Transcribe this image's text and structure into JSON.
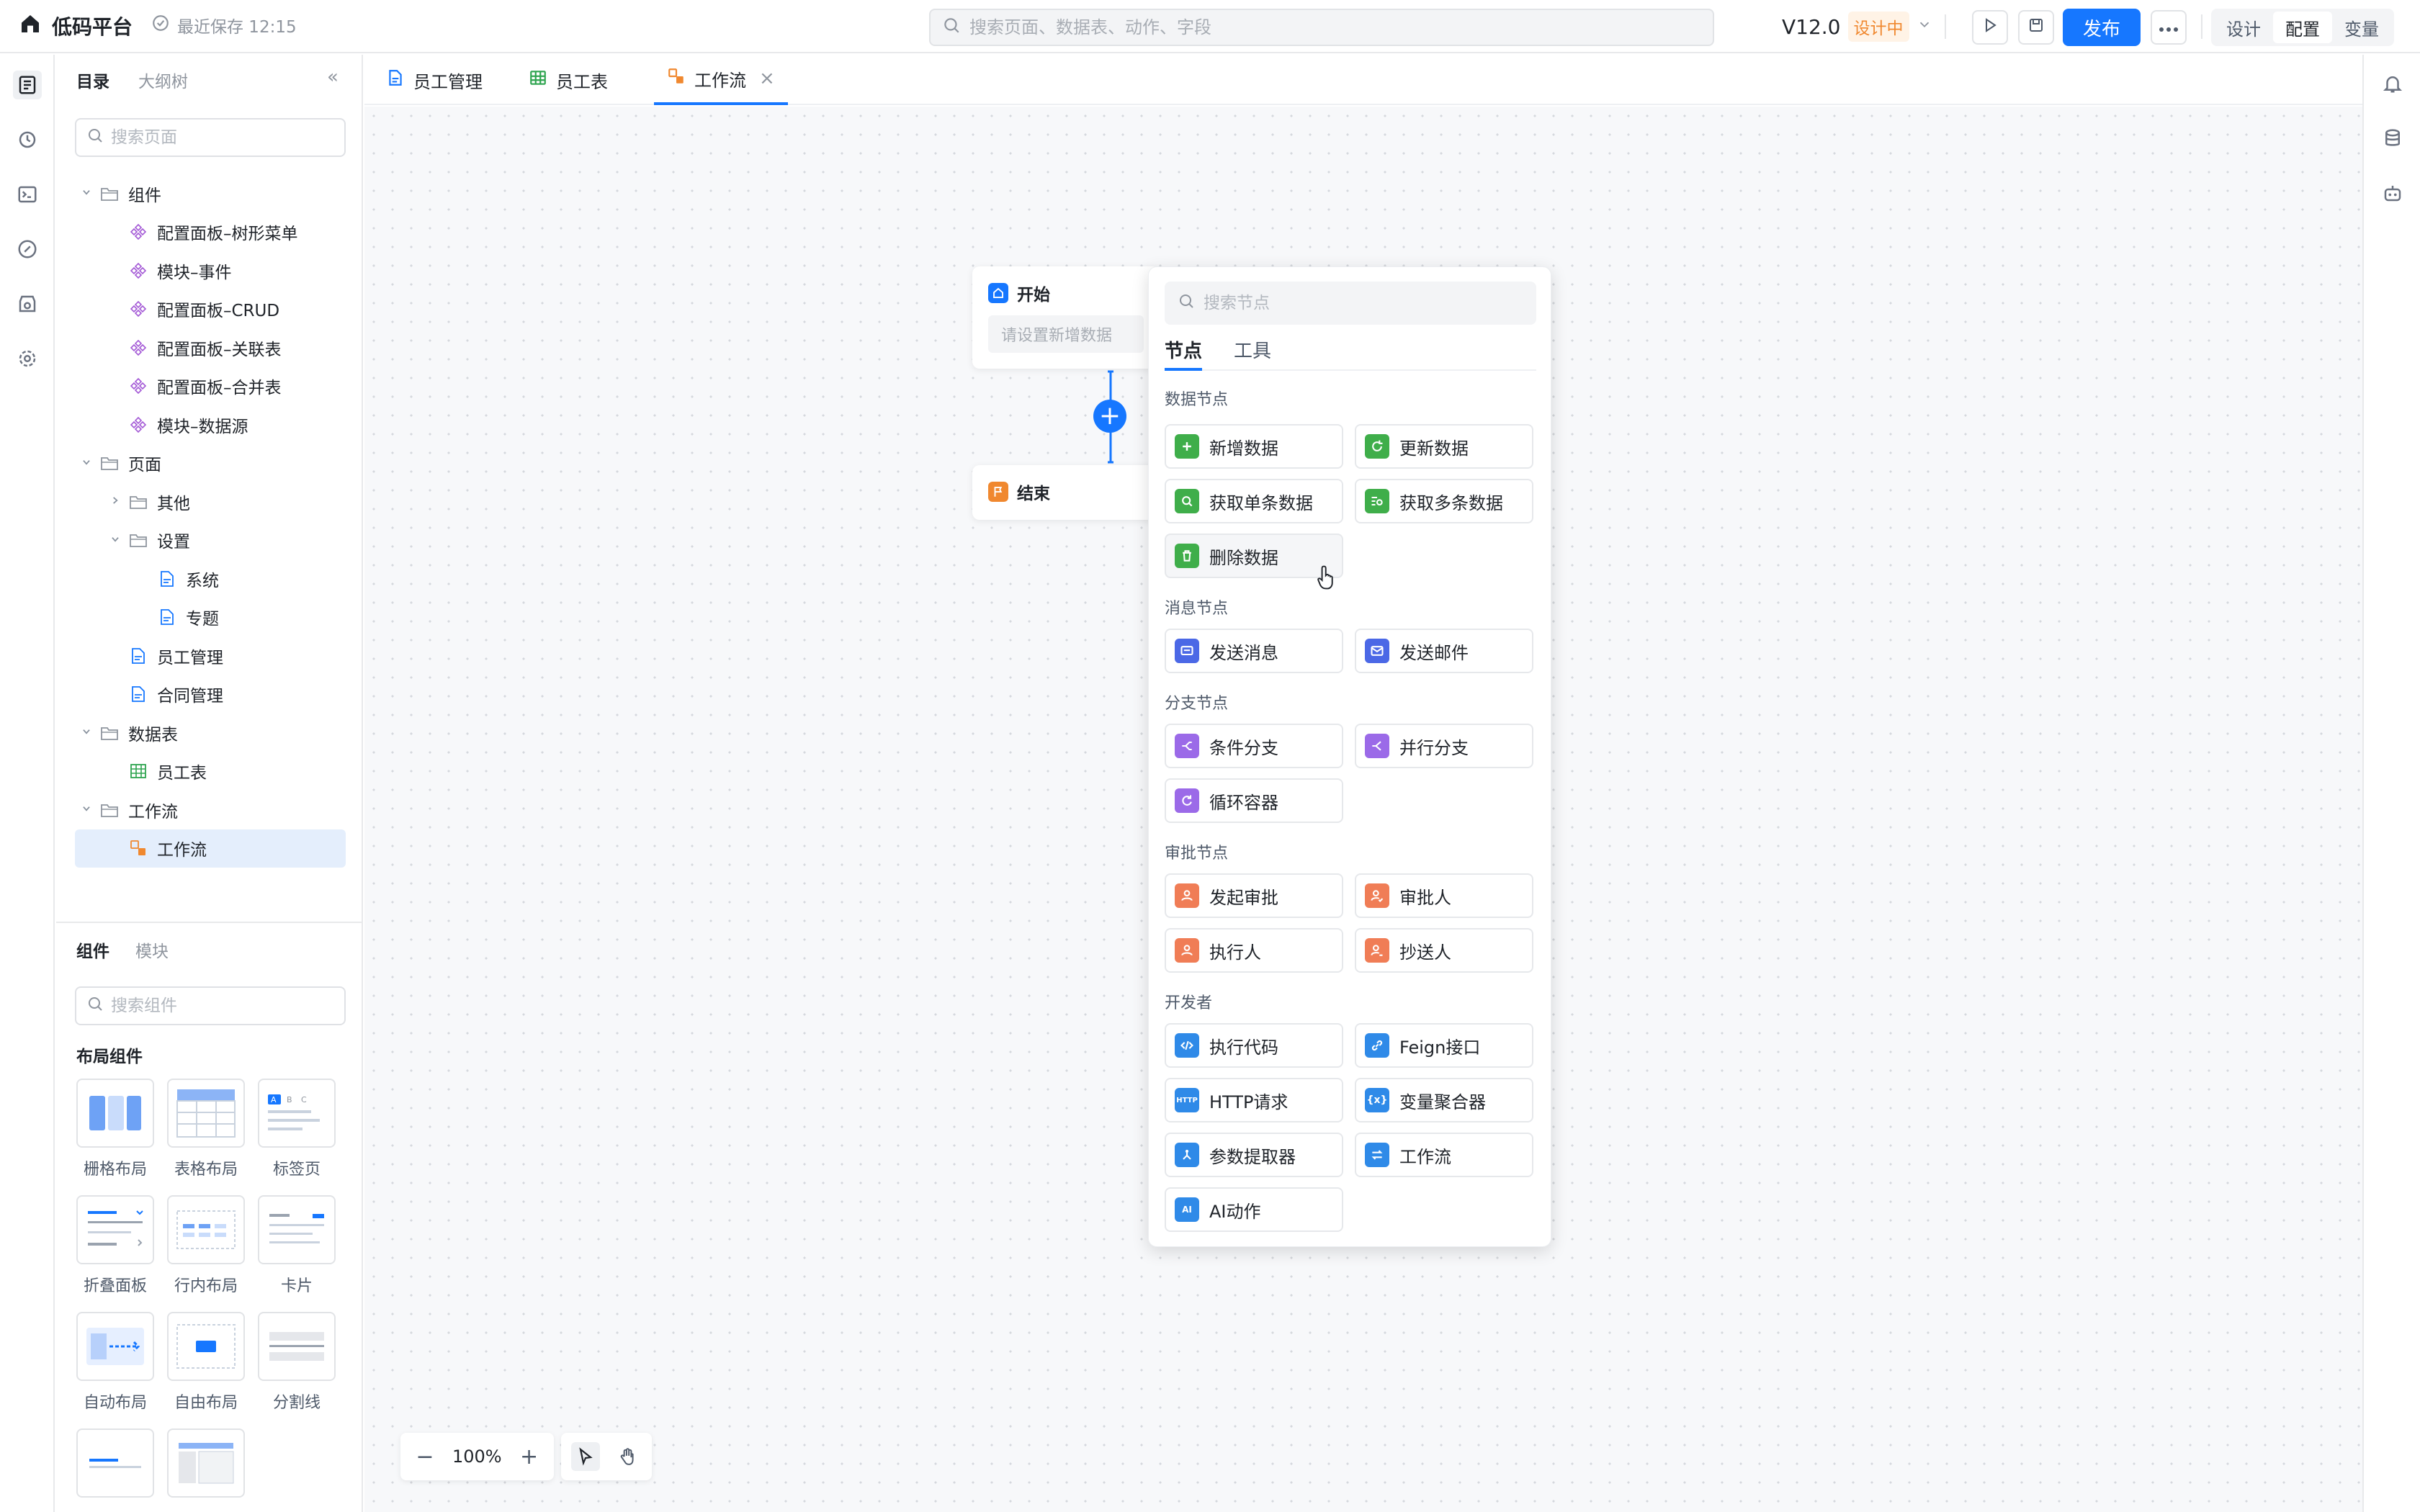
{
  "app": {
    "name": "低码平台",
    "saved": "最近保存 12:15"
  },
  "header": {
    "search_placeholder": "搜索页面、数据表、动作、字段",
    "version": "V12.0",
    "status": "设计中",
    "publish": "发布",
    "modes": [
      "设计",
      "配置",
      "变量"
    ],
    "active_mode": "配置",
    "colors": {
      "primary": "#1677ff",
      "status": "#f0882f"
    }
  },
  "left_rail": {
    "icons": [
      "page-tree-icon",
      "history-icon",
      "terminal-icon",
      "link-icon",
      "store-icon",
      "settings-icon"
    ]
  },
  "right_rail": {
    "icons": [
      "bell-icon",
      "database-icon",
      "robot-icon"
    ]
  },
  "sidebar": {
    "tabs": [
      "目录",
      "大纲树"
    ],
    "collapse_icon": "«",
    "search_placeholder": "搜索页面",
    "tree": [
      {
        "label": "组件",
        "level": 0,
        "type": "folder",
        "expanded": true
      },
      {
        "label": "配置面板–树形菜单",
        "level": 1,
        "type": "component"
      },
      {
        "label": "模块–事件",
        "level": 1,
        "type": "component"
      },
      {
        "label": "配置面板–CRUD",
        "level": 1,
        "type": "component"
      },
      {
        "label": "配置面板–关联表",
        "level": 1,
        "type": "component"
      },
      {
        "label": "配置面板–合并表",
        "level": 1,
        "type": "component"
      },
      {
        "label": "模块–数据源",
        "level": 1,
        "type": "component"
      },
      {
        "label": "页面",
        "level": 0,
        "type": "folder",
        "expanded": true
      },
      {
        "label": "其他",
        "level": 1,
        "type": "folder",
        "expanded": false
      },
      {
        "label": "设置",
        "level": 1,
        "type": "folder",
        "expanded": true
      },
      {
        "label": "系统",
        "level": 2,
        "type": "page"
      },
      {
        "label": "专题",
        "level": 2,
        "type": "page"
      },
      {
        "label": "员工管理",
        "level": 1,
        "type": "page"
      },
      {
        "label": "合同管理",
        "level": 1,
        "type": "page"
      },
      {
        "label": "数据表",
        "level": 0,
        "type": "folder",
        "expanded": true
      },
      {
        "label": "员工表",
        "level": 1,
        "type": "table"
      },
      {
        "label": "工作流",
        "level": 0,
        "type": "folder",
        "expanded": true
      },
      {
        "label": "工作流",
        "level": 1,
        "type": "workflow",
        "selected": true
      }
    ]
  },
  "components_panel": {
    "tabs": [
      "组件",
      "模块"
    ],
    "search_placeholder": "搜索组件",
    "section": "布局组件",
    "items": [
      "栅格布局",
      "表格布局",
      "标签页",
      "折叠面板",
      "行内布局",
      "卡片",
      "自动布局",
      "自由布局",
      "分割线",
      "",
      ""
    ]
  },
  "editor_tabs": [
    {
      "label": "员工管理",
      "icon": "page-icon"
    },
    {
      "label": "员工表",
      "icon": "table-icon"
    },
    {
      "label": "工作流",
      "icon": "workflow-icon",
      "active": true,
      "closable": true
    }
  ],
  "flow": {
    "start": {
      "title": "开始",
      "placeholder": "请设置新增数据"
    },
    "end": {
      "title": "结束"
    }
  },
  "node_picker": {
    "search_placeholder": "搜索节点",
    "tabs": [
      "节点",
      "工具"
    ],
    "sections": {
      "data": {
        "title": "数据节点",
        "items": [
          {
            "label": "新增数据",
            "color": "#3fae4a",
            "icon": "plus-icon"
          },
          {
            "label": "更新数据",
            "color": "#3fae4a",
            "icon": "refresh-icon"
          },
          {
            "label": "获取单条数据",
            "color": "#3fae4a",
            "icon": "search-icon"
          },
          {
            "label": "获取多条数据",
            "color": "#3fae4a",
            "icon": "list-search-icon"
          },
          {
            "label": "删除数据",
            "color": "#3fae4a",
            "icon": "trash-icon"
          }
        ]
      },
      "message": {
        "title": "消息节点",
        "items": [
          {
            "label": "发送消息",
            "color": "#4b68e6",
            "icon": "message-icon"
          },
          {
            "label": "发送邮件",
            "color": "#4b68e6",
            "icon": "mail-icon"
          }
        ]
      },
      "branch": {
        "title": "分支节点",
        "items": [
          {
            "label": "条件分支",
            "color": "#9b6ae8",
            "icon": "branch-icon"
          },
          {
            "label": "并行分支",
            "color": "#9b6ae8",
            "icon": "parallel-icon"
          },
          {
            "label": "循环容器",
            "color": "#9b6ae8",
            "icon": "loop-icon"
          }
        ]
      },
      "approval": {
        "title": "审批节点",
        "items": [
          {
            "label": "发起审批",
            "color": "#f07d56",
            "icon": "user-icon"
          },
          {
            "label": "审批人",
            "color": "#f07d56",
            "icon": "user-check-icon"
          },
          {
            "label": "执行人",
            "color": "#f07d56",
            "icon": "user-icon"
          },
          {
            "label": "抄送人",
            "color": "#f07d56",
            "icon": "user-cc-icon"
          }
        ]
      },
      "developer": {
        "title": "开发者",
        "items": [
          {
            "label": "执行代码",
            "color": "#2f8ae8",
            "icon": "code-icon"
          },
          {
            "label": "Feign接口",
            "color": "#2f8ae8",
            "icon": "link-icon"
          },
          {
            "label": "HTTP请求",
            "color": "#2f8ae8",
            "icon": "http-icon",
            "badge": "HTTP"
          },
          {
            "label": "变量聚合器",
            "color": "#2f8ae8",
            "icon": "variable-icon",
            "badge": "{x}"
          },
          {
            "label": "参数提取器",
            "color": "#2f8ae8",
            "icon": "extract-icon"
          },
          {
            "label": "工作流",
            "color": "#2f8ae8",
            "icon": "workflow-icon"
          },
          {
            "label": "AI动作",
            "color": "#2f8ae8",
            "icon": "ai-icon",
            "badge": "AI"
          }
        ]
      }
    }
  },
  "zoom": {
    "value": "100%"
  }
}
